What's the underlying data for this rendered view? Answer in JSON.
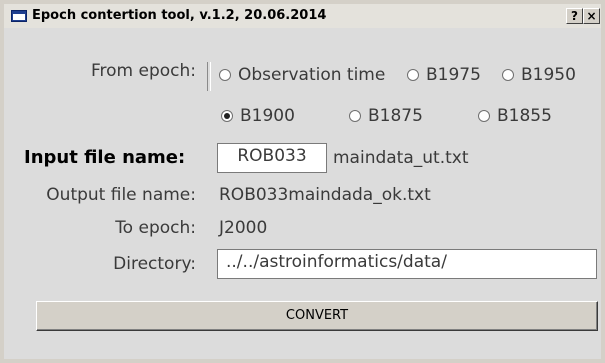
{
  "window": {
    "title": "Epoch contertion tool, v.1.2, 20.06.2014",
    "help_glyph": "?",
    "close_glyph": "×"
  },
  "form": {
    "from_epoch_label": "From epoch:",
    "options": [
      "Observation time",
      "B1975",
      "B1950",
      "B1900",
      "B1875",
      "B1855"
    ],
    "selected_option": "B1900",
    "input_file_label": "Input file name:",
    "input_file_prefix": "ROB033",
    "input_file_suffix": "maindata_ut.txt",
    "output_file_label": "Output file name:",
    "output_file_value": "ROB033maindada_ok.txt",
    "to_epoch_label": "To epoch:",
    "to_epoch_value": "J2000",
    "directory_label": "Directory:",
    "directory_value": "../../astroinformatics/data/",
    "convert_label": "CONVERT"
  }
}
